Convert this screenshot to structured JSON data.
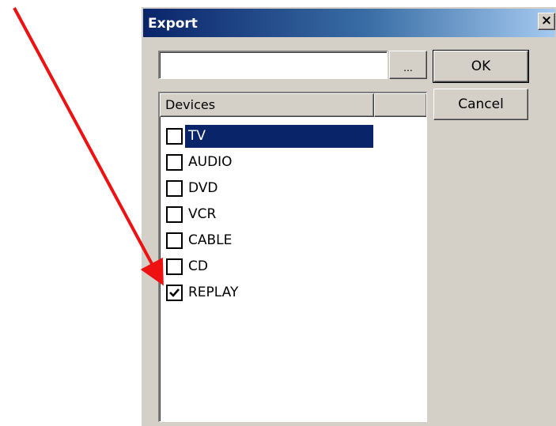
{
  "dialog": {
    "title": "Export",
    "close_label": "×",
    "path_value": "",
    "browse_label": "...",
    "ok_label": "OK",
    "cancel_label": "Cancel"
  },
  "device_list": {
    "columns": [
      "Devices",
      ""
    ],
    "items": [
      {
        "label": "TV",
        "checked": false,
        "selected": true
      },
      {
        "label": "AUDIO",
        "checked": false,
        "selected": false
      },
      {
        "label": "DVD",
        "checked": false,
        "selected": false
      },
      {
        "label": "VCR",
        "checked": false,
        "selected": false
      },
      {
        "label": "CABLE",
        "checked": false,
        "selected": false
      },
      {
        "label": "CD",
        "checked": false,
        "selected": false
      },
      {
        "label": "REPLAY",
        "checked": true,
        "selected": false
      }
    ]
  },
  "annotation": {
    "arrow_color": "#ee1111",
    "target": "REPLAY"
  },
  "colors": {
    "titlebar_start": "#0a246a",
    "titlebar_end": "#a6caf0",
    "window_face": "#d4d0c8",
    "selection": "#0a246a"
  }
}
